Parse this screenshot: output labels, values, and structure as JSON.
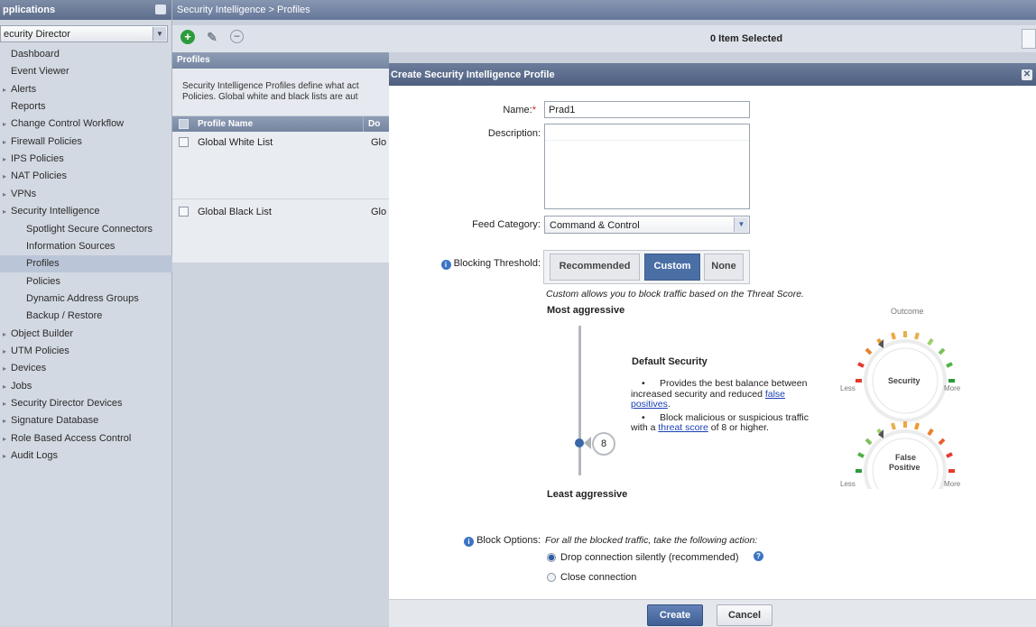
{
  "sidebar": {
    "header": "pplications",
    "selector": "ecurity Director",
    "items": [
      {
        "label": "Dashboard",
        "level": 1
      },
      {
        "label": "Event Viewer",
        "level": 1
      },
      {
        "label": "Alerts",
        "level": 1,
        "expandable": true
      },
      {
        "label": "Reports",
        "level": 1
      },
      {
        "label": "Change Control Workflow",
        "level": 1,
        "expandable": true
      },
      {
        "label": "Firewall Policies",
        "level": 1,
        "expandable": true
      },
      {
        "label": "IPS Policies",
        "level": 1,
        "expandable": true
      },
      {
        "label": "NAT Policies",
        "level": 1,
        "expandable": true
      },
      {
        "label": "VPNs",
        "level": 1,
        "expandable": true
      },
      {
        "label": "Security Intelligence",
        "level": 1,
        "expandable": true
      },
      {
        "label": "Spotlight Secure Connectors",
        "level": 2
      },
      {
        "label": "Information Sources",
        "level": 2
      },
      {
        "label": "Profiles",
        "level": 2,
        "selected": true
      },
      {
        "label": "Policies",
        "level": 2
      },
      {
        "label": "Dynamic Address Groups",
        "level": 2
      },
      {
        "label": "Backup / Restore",
        "level": 2
      },
      {
        "label": "Object Builder",
        "level": 1,
        "expandable": true
      },
      {
        "label": "UTM Policies",
        "level": 1,
        "expandable": true
      },
      {
        "label": "Devices",
        "level": 1,
        "expandable": true
      },
      {
        "label": "Jobs",
        "level": 1,
        "expandable": true
      },
      {
        "label": "Security Director Devices",
        "level": 1,
        "expandable": true
      },
      {
        "label": "Signature Database",
        "level": 1,
        "expandable": true
      },
      {
        "label": "Role Based Access Control",
        "level": 1,
        "expandable": true
      },
      {
        "label": "Audit Logs",
        "level": 1,
        "expandable": true
      }
    ]
  },
  "breadcrumb": "Security Intelligence  >  Profiles",
  "toolbar": {
    "selection_count": "0 Item Selected"
  },
  "profiles": {
    "title": "Profiles",
    "description_line1": "Security Intelligence Profiles define what act",
    "description_line2": "Policies. Global white and black lists are aut",
    "columns": [
      "Profile Name",
      "Do"
    ],
    "rows": [
      {
        "name": "Global White List",
        "col2": "Glo"
      },
      {
        "name": "Global Black List",
        "col2": "Glo"
      }
    ]
  },
  "dialog": {
    "title": "Create Security Intelligence Profile",
    "name_label": "Name:",
    "required_mark": "*",
    "name_value": "Prad1",
    "description_label": "Description:",
    "feed_category_label": "Feed Category:",
    "feed_category_value": "Command & Control",
    "blocking_threshold_label": "Blocking Threshold:",
    "threshold_options": [
      "Recommended",
      "Custom",
      "None"
    ],
    "threshold_selected": "Custom",
    "custom_hint": "Custom allows you to block traffic based on the Threat Score.",
    "most_aggressive": "Most aggressive",
    "least_aggressive": "Least aggressive",
    "threat_score": 8,
    "threat_score_label": "8",
    "default_security": {
      "title": "Default Security",
      "bullet1_text": "Provides the best balance between increased security and reduced ",
      "bullet1_link": "false positives",
      "bullet1_end": ".",
      "bullet2_text": "Block malicious or suspicious traffic with a ",
      "bullet2_link": "threat score",
      "bullet2_end": " of 8 or higher."
    },
    "gauges": {
      "outcome_label": "Outcome",
      "security_label": "Security",
      "false_positive_label_1": "False",
      "false_positive_label_2": "Positive",
      "less": "Less",
      "more": "More"
    },
    "block_options_label": "Block Options:",
    "block_options_hint": "For all the blocked traffic, take the following action:",
    "block_options": [
      {
        "label": "Drop connection silently (recommended)",
        "selected": true
      },
      {
        "label": "Close connection",
        "selected": false
      }
    ],
    "create_button": "Create",
    "cancel_button": "Cancel"
  },
  "colors": {
    "accent": "#3d75c4",
    "dialog_header": "#5a6b8a",
    "add_green": "#2e9a3c"
  }
}
